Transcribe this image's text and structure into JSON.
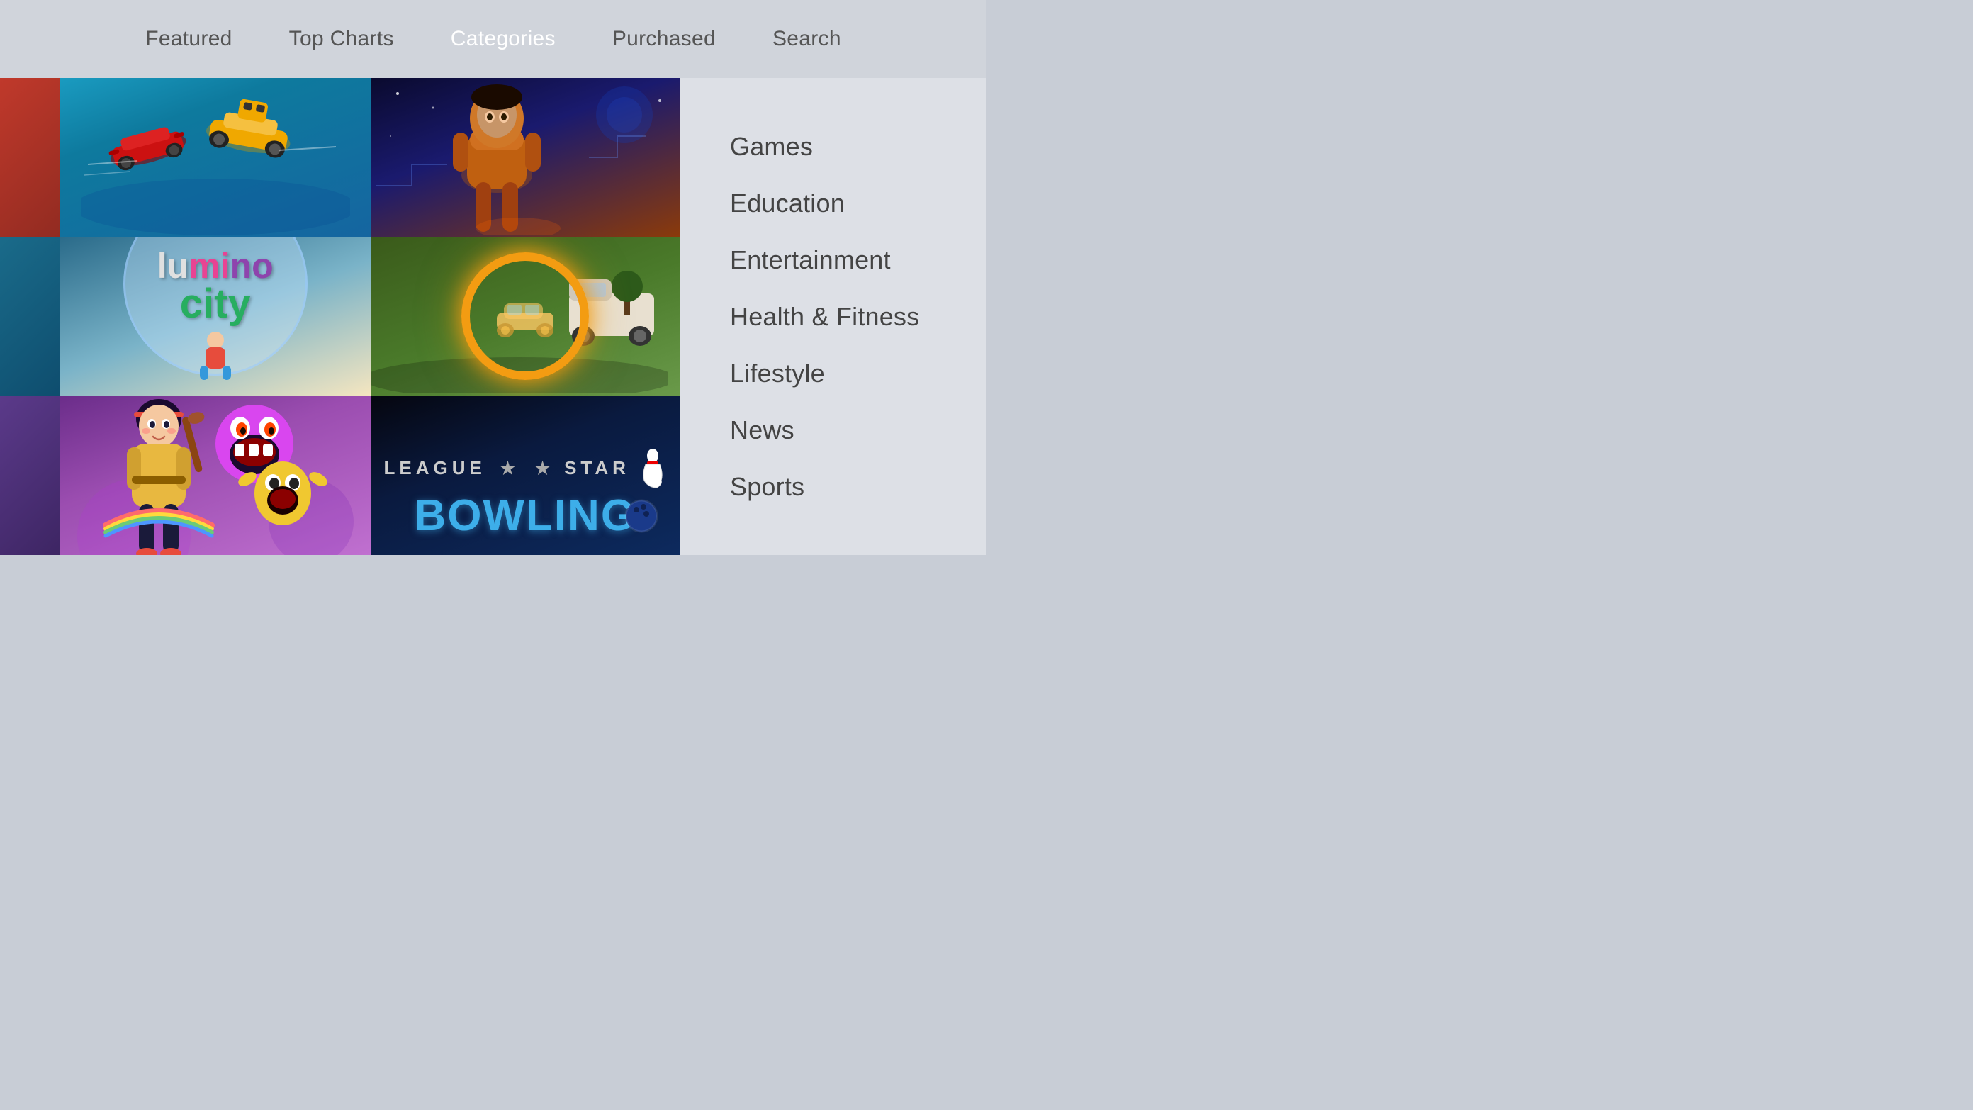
{
  "nav": {
    "items": [
      {
        "id": "featured",
        "label": "Featured",
        "active": false
      },
      {
        "id": "top-charts",
        "label": "Top Charts",
        "active": false
      },
      {
        "id": "categories",
        "label": "Categories",
        "active": true
      },
      {
        "id": "purchased",
        "label": "Purchased",
        "active": false
      },
      {
        "id": "search",
        "label": "Search",
        "active": false
      }
    ]
  },
  "categories": {
    "items": [
      {
        "id": "games",
        "label": "Games"
      },
      {
        "id": "education",
        "label": "Education"
      },
      {
        "id": "entertainment",
        "label": "Entertainment"
      },
      {
        "id": "health-fitness",
        "label": "Health & Fitness"
      },
      {
        "id": "lifestyle",
        "label": "Lifestyle"
      },
      {
        "id": "news",
        "label": "News"
      },
      {
        "id": "sports",
        "label": "Sports"
      }
    ]
  },
  "grid": {
    "lumino": {
      "lu": "lu",
      "mi": "mi",
      "no": "no",
      "city": "city"
    },
    "bowling": {
      "league": "LEAGUE",
      "star": "★",
      "star2": "★",
      "main": "BOWLING"
    }
  }
}
